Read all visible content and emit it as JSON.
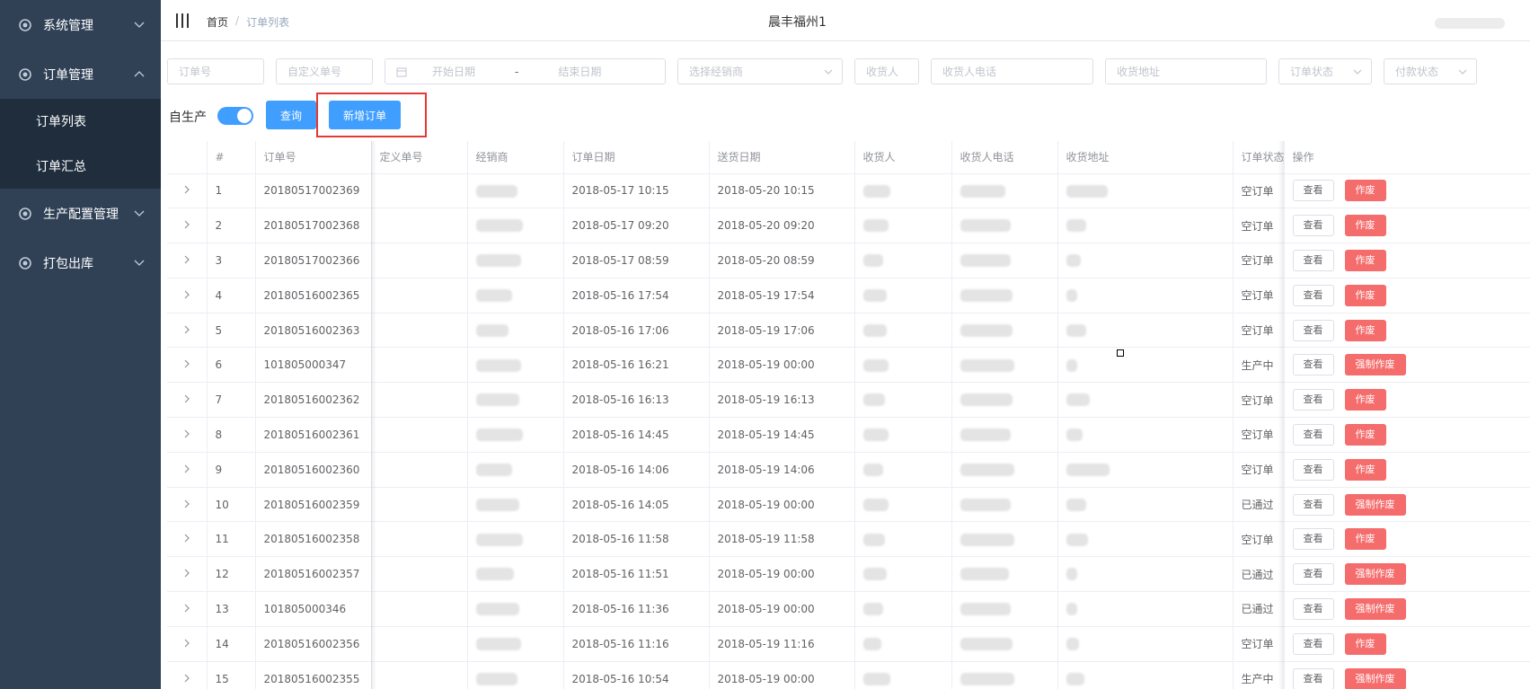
{
  "sidebar": {
    "items": [
      {
        "label": "系统管理"
      },
      {
        "label": "订单管理"
      },
      {
        "label": "生产配置管理"
      },
      {
        "label": "打包出库"
      }
    ],
    "sub_items": [
      {
        "label": "订单列表"
      },
      {
        "label": "订单汇总"
      }
    ]
  },
  "header": {
    "breadcrumb": {
      "home": "首页",
      "sep": "/",
      "current": "订单列表"
    },
    "title": "晨丰福州1"
  },
  "filters": {
    "order_no": "订单号",
    "custom_no": "自定义单号",
    "start_date": "开始日期",
    "date_sep": "-",
    "end_date": "结束日期",
    "dealer": "选择经销商",
    "receiver": "收货人",
    "receiver_phone": "收货人电话",
    "address": "收货地址",
    "order_status": "订单状态",
    "pay_status": "付款状态"
  },
  "actions": {
    "self_produce_label": "自生产",
    "self_produce_on": true,
    "query_label": "查询",
    "new_order_label": "新增订单"
  },
  "table": {
    "columns": [
      "#",
      "订单号",
      "定义单号",
      "经销商",
      "订单日期",
      "送货日期",
      "收货人",
      "收货人电话",
      "收货地址",
      "订单状态",
      "操作"
    ],
    "view_label": "查看",
    "rows": [
      {
        "idx": "1",
        "order_no": "20180517002369",
        "order_date": "2018-05-17 10:15",
        "delivery_date": "2018-05-20 10:15",
        "status": "空订单",
        "void_label": "作废"
      },
      {
        "idx": "2",
        "order_no": "20180517002368",
        "order_date": "2018-05-17 09:20",
        "delivery_date": "2018-05-20 09:20",
        "status": "空订单",
        "void_label": "作废"
      },
      {
        "idx": "3",
        "order_no": "20180517002366",
        "order_date": "2018-05-17 08:59",
        "delivery_date": "2018-05-20 08:59",
        "status": "空订单",
        "void_label": "作废"
      },
      {
        "idx": "4",
        "order_no": "20180516002365",
        "order_date": "2018-05-16 17:54",
        "delivery_date": "2018-05-19 17:54",
        "status": "空订单",
        "void_label": "作废"
      },
      {
        "idx": "5",
        "order_no": "20180516002363",
        "order_date": "2018-05-16 17:06",
        "delivery_date": "2018-05-19 17:06",
        "status": "空订单",
        "void_label": "作废"
      },
      {
        "idx": "6",
        "order_no": "101805000347",
        "order_date": "2018-05-16 16:21",
        "delivery_date": "2018-05-19 00:00",
        "status": "生产中",
        "void_label": "强制作废"
      },
      {
        "idx": "7",
        "order_no": "20180516002362",
        "order_date": "2018-05-16 16:13",
        "delivery_date": "2018-05-19 16:13",
        "status": "空订单",
        "void_label": "作废"
      },
      {
        "idx": "8",
        "order_no": "20180516002361",
        "order_date": "2018-05-16 14:45",
        "delivery_date": "2018-05-19 14:45",
        "status": "空订单",
        "void_label": "作废"
      },
      {
        "idx": "9",
        "order_no": "20180516002360",
        "order_date": "2018-05-16 14:06",
        "delivery_date": "2018-05-19 14:06",
        "status": "空订单",
        "void_label": "作废"
      },
      {
        "idx": "10",
        "order_no": "20180516002359",
        "order_date": "2018-05-16 14:05",
        "delivery_date": "2018-05-19 00:00",
        "status": "已通过",
        "void_label": "强制作废"
      },
      {
        "idx": "11",
        "order_no": "20180516002358",
        "order_date": "2018-05-16 11:58",
        "delivery_date": "2018-05-19 11:58",
        "status": "空订单",
        "void_label": "作废"
      },
      {
        "idx": "12",
        "order_no": "20180516002357",
        "order_date": "2018-05-16 11:51",
        "delivery_date": "2018-05-19 00:00",
        "status": "已通过",
        "void_label": "强制作废"
      },
      {
        "idx": "13",
        "order_no": "101805000346",
        "order_date": "2018-05-16 11:36",
        "delivery_date": "2018-05-19 00:00",
        "status": "已通过",
        "void_label": "强制作废"
      },
      {
        "idx": "14",
        "order_no": "20180516002356",
        "order_date": "2018-05-16 11:16",
        "delivery_date": "2018-05-19 11:16",
        "status": "空订单",
        "void_label": "作废"
      },
      {
        "idx": "15",
        "order_no": "20180516002355",
        "order_date": "2018-05-16 10:54",
        "delivery_date": "2018-05-19 00:00",
        "status": "生产中",
        "void_label": "强制作废"
      }
    ]
  }
}
